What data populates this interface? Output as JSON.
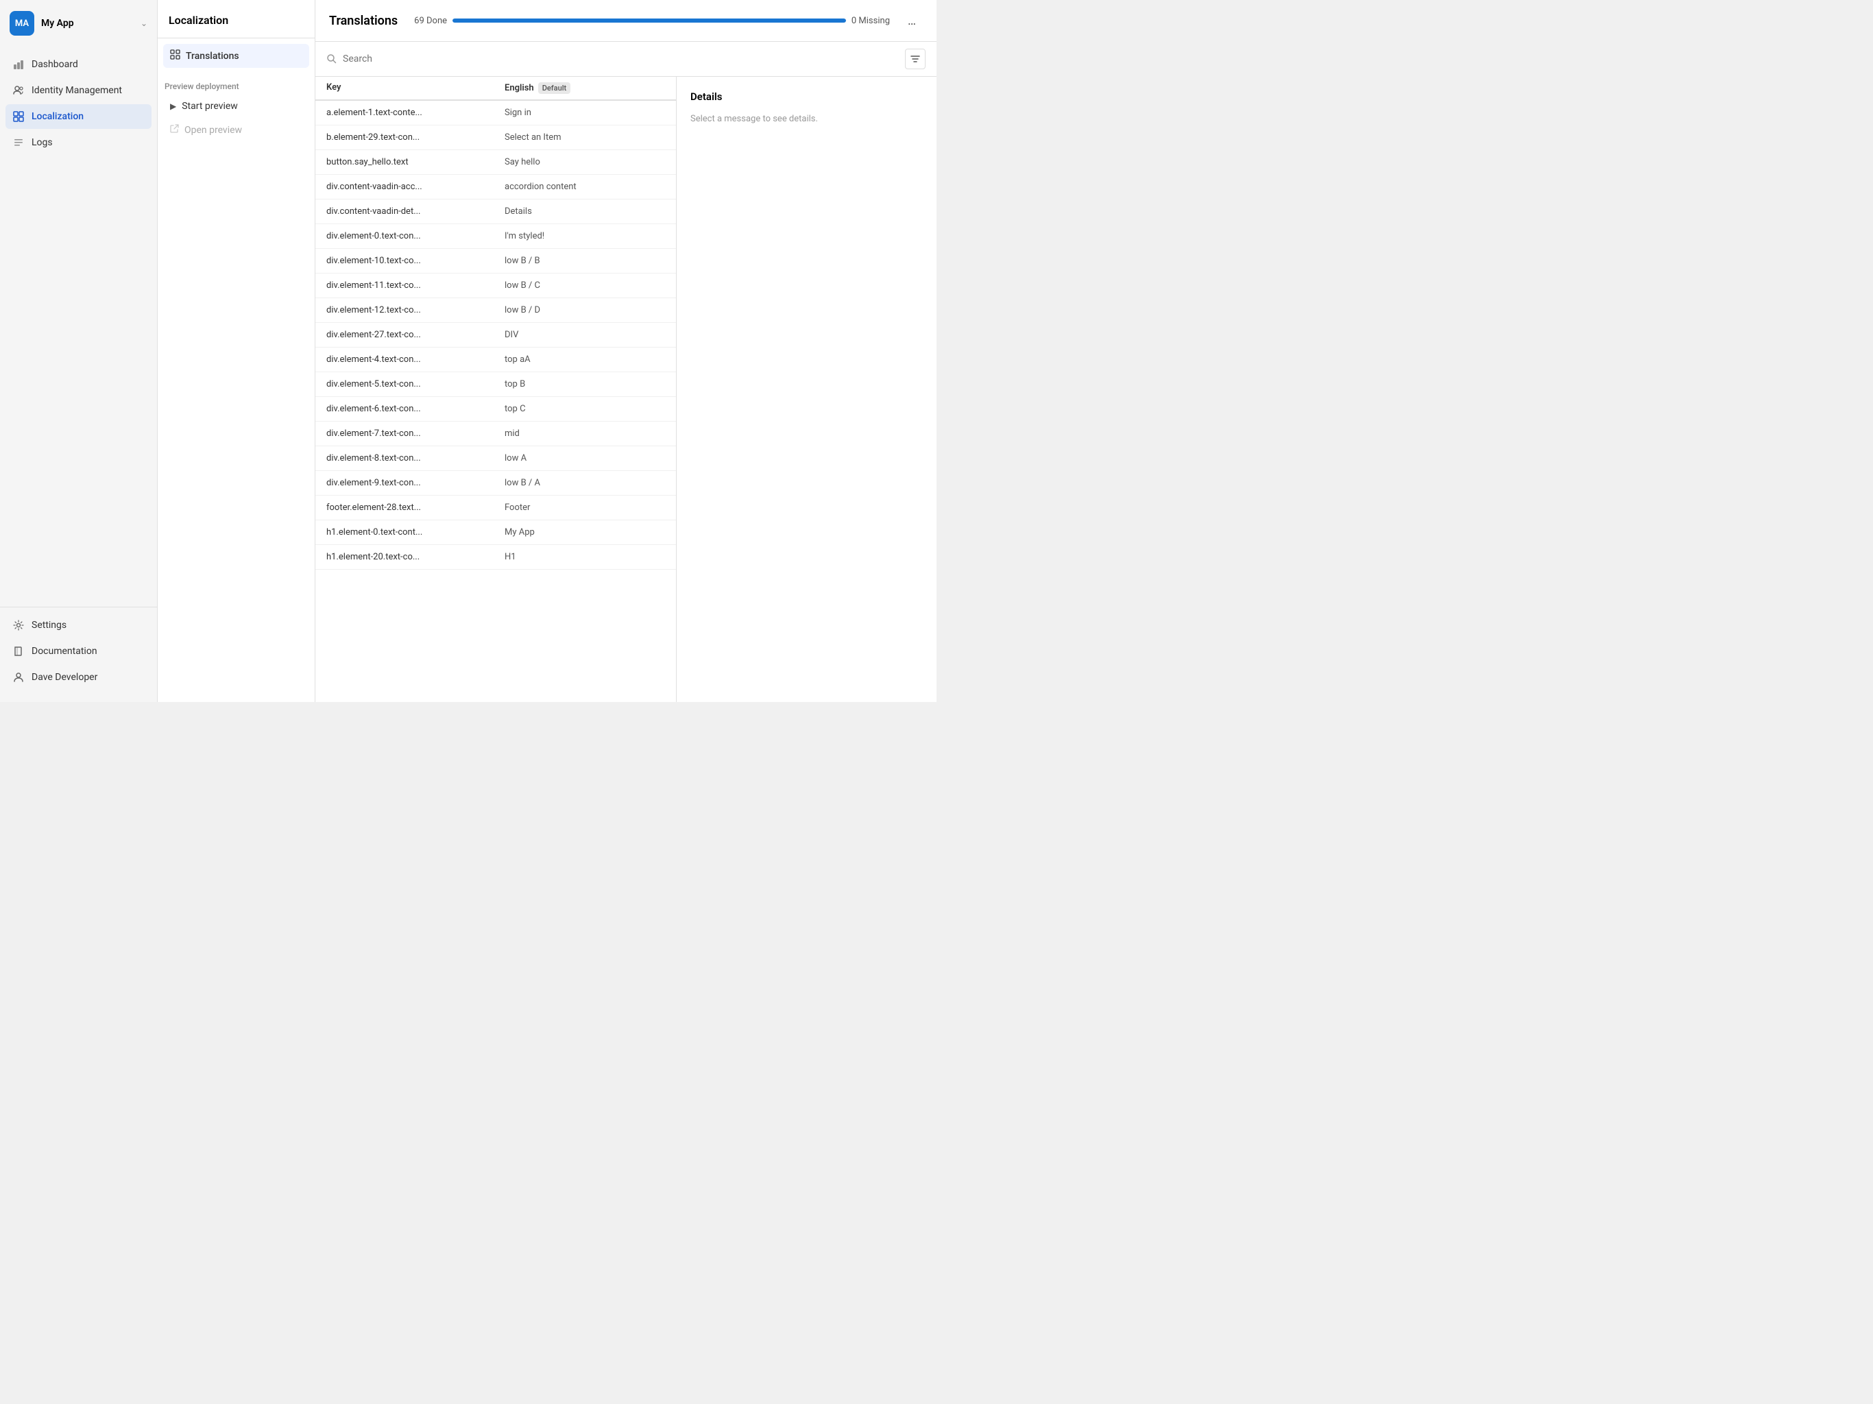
{
  "sidebar": {
    "app_initials": "MA",
    "app_name": "My App",
    "nav_items": [
      {
        "id": "dashboard",
        "label": "Dashboard",
        "icon": "chart-icon",
        "active": false
      },
      {
        "id": "identity",
        "label": "Identity Management",
        "icon": "users-icon",
        "active": false
      },
      {
        "id": "localization",
        "label": "Localization",
        "icon": "grid-icon",
        "active": true
      },
      {
        "id": "logs",
        "label": "Logs",
        "icon": "list-icon",
        "active": false
      }
    ],
    "bottom_items": [
      {
        "id": "settings",
        "label": "Settings",
        "icon": "gear-icon"
      },
      {
        "id": "documentation",
        "label": "Documentation",
        "icon": "book-icon"
      },
      {
        "id": "user",
        "label": "Dave Developer",
        "icon": "user-icon"
      }
    ]
  },
  "localization": {
    "panel_title": "Localization",
    "nav_items": [
      {
        "id": "translations",
        "label": "Translations",
        "icon": "translations-icon"
      }
    ],
    "preview_section_title": "Preview deployment",
    "preview_actions": [
      {
        "id": "start-preview",
        "label": "Start preview",
        "icon": "play-icon",
        "disabled": false
      },
      {
        "id": "open-preview",
        "label": "Open preview",
        "icon": "external-icon",
        "disabled": true
      }
    ]
  },
  "translations": {
    "title": "Translations",
    "progress_done": "69 Done",
    "progress_missing": "0 Missing",
    "progress_percent": 100,
    "search_placeholder": "Search",
    "column_key": "Key",
    "column_lang": "English",
    "column_lang_badge": "Default",
    "details_title": "Details",
    "details_placeholder": "Select a message to see details.",
    "rows": [
      {
        "key": "a.element-1.text-conte...",
        "value": "Sign in"
      },
      {
        "key": "b.element-29.text-con...",
        "value": "Select an Item"
      },
      {
        "key": "button.say_hello.text",
        "value": "Say hello"
      },
      {
        "key": "div.content-vaadin-acc...",
        "value": "accordion content"
      },
      {
        "key": "div.content-vaadin-det...",
        "value": "Details"
      },
      {
        "key": "div.element-0.text-con...",
        "value": "I'm styled!"
      },
      {
        "key": "div.element-10.text-co...",
        "value": "low B / B"
      },
      {
        "key": "div.element-11.text-co...",
        "value": "low B / C"
      },
      {
        "key": "div.element-12.text-co...",
        "value": "low B / D"
      },
      {
        "key": "div.element-27.text-co...",
        "value": "DIV"
      },
      {
        "key": "div.element-4.text-con...",
        "value": "top aA"
      },
      {
        "key": "div.element-5.text-con...",
        "value": "top B"
      },
      {
        "key": "div.element-6.text-con...",
        "value": "top C"
      },
      {
        "key": "div.element-7.text-con...",
        "value": "mid"
      },
      {
        "key": "div.element-8.text-con...",
        "value": "low A"
      },
      {
        "key": "div.element-9.text-con...",
        "value": "low B / A"
      },
      {
        "key": "footer.element-28.text...",
        "value": "Footer"
      },
      {
        "key": "h1.element-0.text-cont...",
        "value": "My App"
      },
      {
        "key": "h1.element-20.text-co...",
        "value": "H1"
      }
    ]
  }
}
